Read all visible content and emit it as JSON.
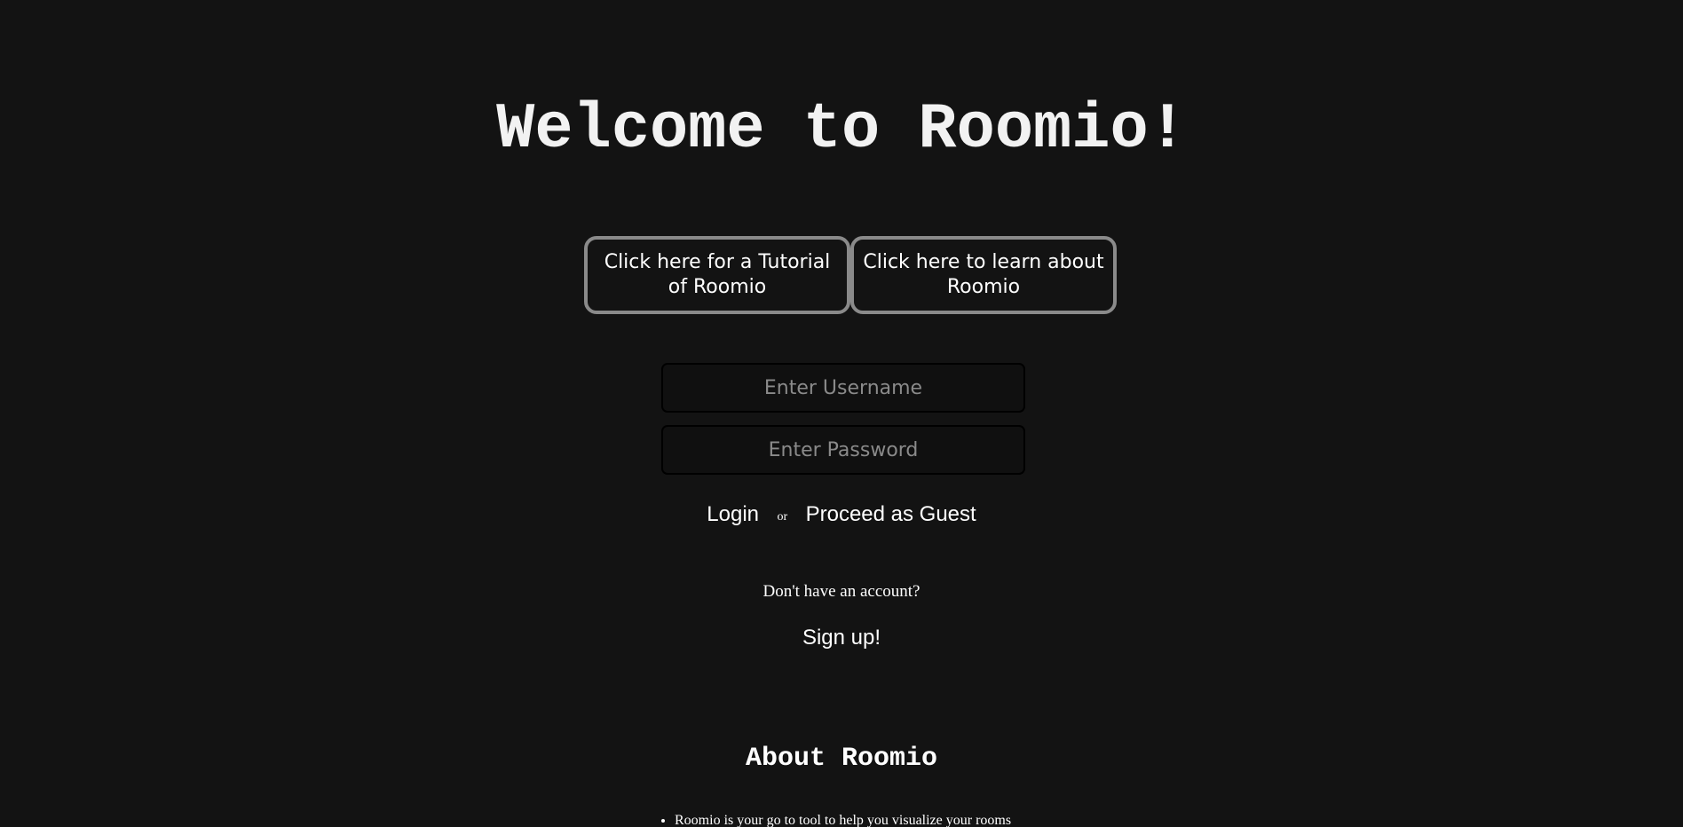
{
  "page": {
    "title": "Welcome to Roomio!"
  },
  "info_buttons": {
    "tutorial_label": "Click here for a Tutorial of Roomio",
    "about_label": "Click here to learn about Roomio"
  },
  "login_form": {
    "username_placeholder": "Enter Username",
    "password_placeholder": "Enter Password",
    "login_label": "Login",
    "or_text": "or",
    "guest_label": "Proceed as Guest"
  },
  "signup": {
    "prompt": "Don't have an account?",
    "link_label": "Sign up!"
  },
  "about": {
    "heading": "About Roomio",
    "items": [
      "Roomio is your go to tool to help you visualize your rooms"
    ]
  },
  "colors": {
    "background": "#131313",
    "text": "#ffffff",
    "button_border": "#8a8a8a",
    "placeholder": "#8a8a8a"
  }
}
